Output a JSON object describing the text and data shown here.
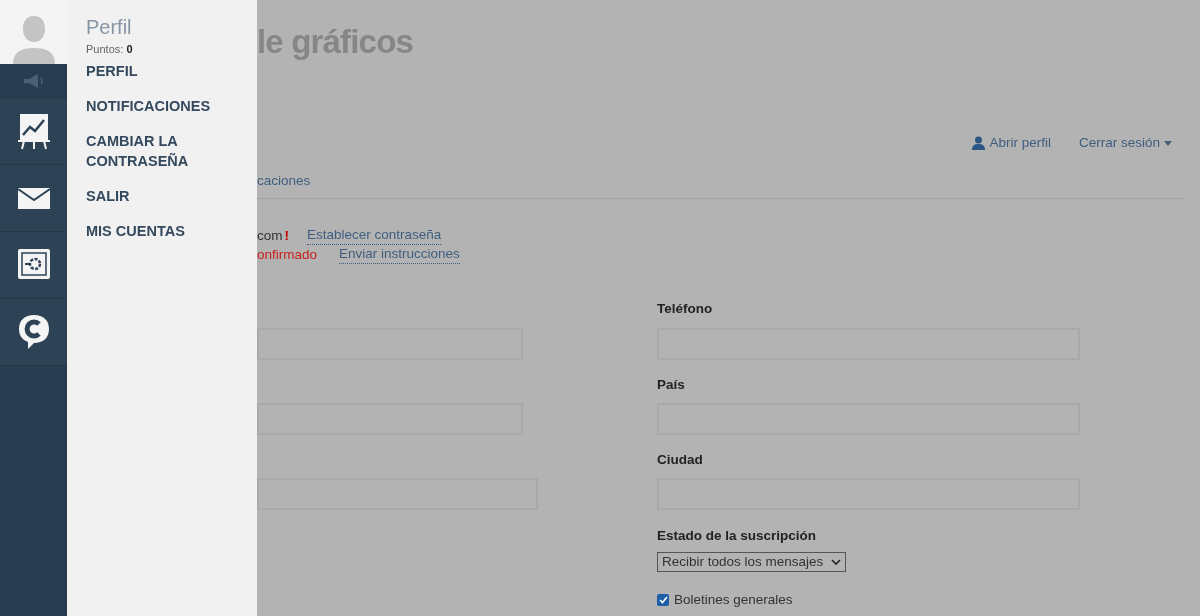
{
  "drawer": {
    "title": "Perfil",
    "points_label": "Puntos:",
    "points_value": "0",
    "items": [
      "PERFIL",
      "NOTIFICACIONES",
      "CAMBIAR LA CONTRASEÑA",
      "SALIR",
      "MIS CUENTAS"
    ]
  },
  "page": {
    "title": "le gráficos",
    "header_links": [
      {
        "kind": "profile",
        "label": "Abrir perfil"
      },
      {
        "kind": "menu",
        "label": "Cerrar sesión"
      }
    ],
    "tab": "caciones",
    "email": "com",
    "email_warning": "!",
    "email_action": "Establecer contraseña",
    "status": "onfirmado",
    "status_action": "Enviar instrucciones",
    "fields": [
      {
        "label": "Teléfono"
      },
      {
        "label": "País"
      },
      {
        "label": "Ciudad"
      }
    ],
    "subscription": {
      "label": "Estado de la suscripción",
      "value": "Recibir todos los mensajes"
    },
    "newsletter": {
      "label": "Boletines generales",
      "checked": true
    }
  }
}
